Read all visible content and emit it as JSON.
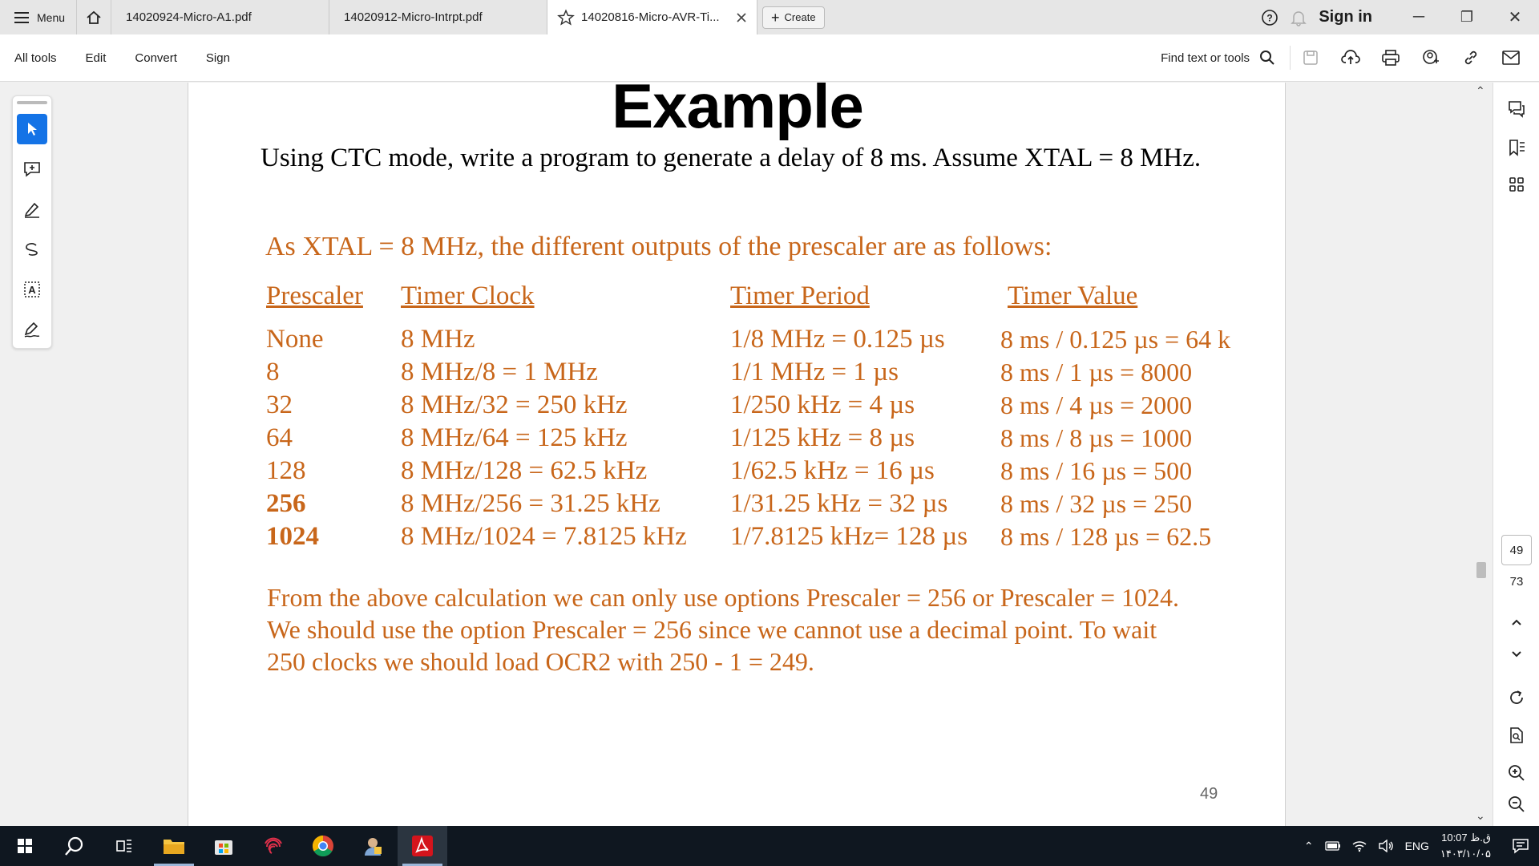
{
  "tabbar": {
    "menu_label": "Menu",
    "tabs": [
      {
        "label": "14020924-Micro-A1.pdf"
      },
      {
        "label": "14020912-Micro-Intrpt.pdf"
      },
      {
        "label": "14020816-Micro-AVR-Ti..."
      }
    ],
    "create_label": "Create",
    "signin_label": "Sign in"
  },
  "toolbar": {
    "menu_items": [
      "All tools",
      "Edit",
      "Convert",
      "Sign"
    ],
    "find_label": "Find text or tools"
  },
  "document": {
    "heading": "Example",
    "problem": "Using CTC mode, write a program to generate a delay of 8 ms. Assume XTAL = 8 MHz.",
    "intro": "As XTAL = 8 MHz, the different outputs of the prescaler are as follows:",
    "table": {
      "headers": [
        "Prescaler",
        "Timer Clock",
        "Timer Period",
        "Timer Value"
      ],
      "rows": [
        [
          "None",
          "8 MHz",
          "1/8 MHz = 0.125 µs",
          "8 ms / 0.125 µs = 64 k"
        ],
        [
          "8",
          "8 MHz/8 = 1 MHz",
          "1/1 MHz = 1 µs",
          "8 ms / 1 µs = 8000"
        ],
        [
          "32",
          "8 MHz/32 = 250 kHz",
          "1/250 kHz = 4 µs",
          "8 ms / 4 µs = 2000"
        ],
        [
          "64",
          "8 MHz/64 = 125 kHz",
          "1/125 kHz = 8 µs",
          "8 ms / 8 µs = 1000"
        ],
        [
          "128",
          "8 MHz/128 = 62.5 kHz",
          "1/62.5 kHz = 16 µs",
          "8 ms / 16 µs = 500"
        ],
        [
          "256",
          "8 MHz/256 = 31.25 kHz",
          "1/31.25 kHz = 32 µs",
          "8 ms / 32 µs = 250"
        ],
        [
          "1024",
          "8 MHz/1024 = 7.8125 kHz",
          "1/7.8125 kHz= 128 µs",
          "8 ms / 128 µs = 62.5"
        ]
      ]
    },
    "conclusion": [
      "From the above calculation we can only use options Prescaler = 256 or Prescaler = 1024.",
      "We should use the option Prescaler = 256 since we cannot use a decimal point. To wait",
      "250 clocks we should load OCR2 with 250 - 1 = 249."
    ],
    "page_footer": "49"
  },
  "navigation": {
    "current_page": "49",
    "total_pages": "73"
  },
  "taskbar": {
    "language": "ENG",
    "time": "10:07 ق.ظ",
    "date": "۱۴۰۳/۱۰/۰۵"
  },
  "colors": {
    "accent": "#1473e6",
    "document_text_orange": "#c8661a"
  }
}
